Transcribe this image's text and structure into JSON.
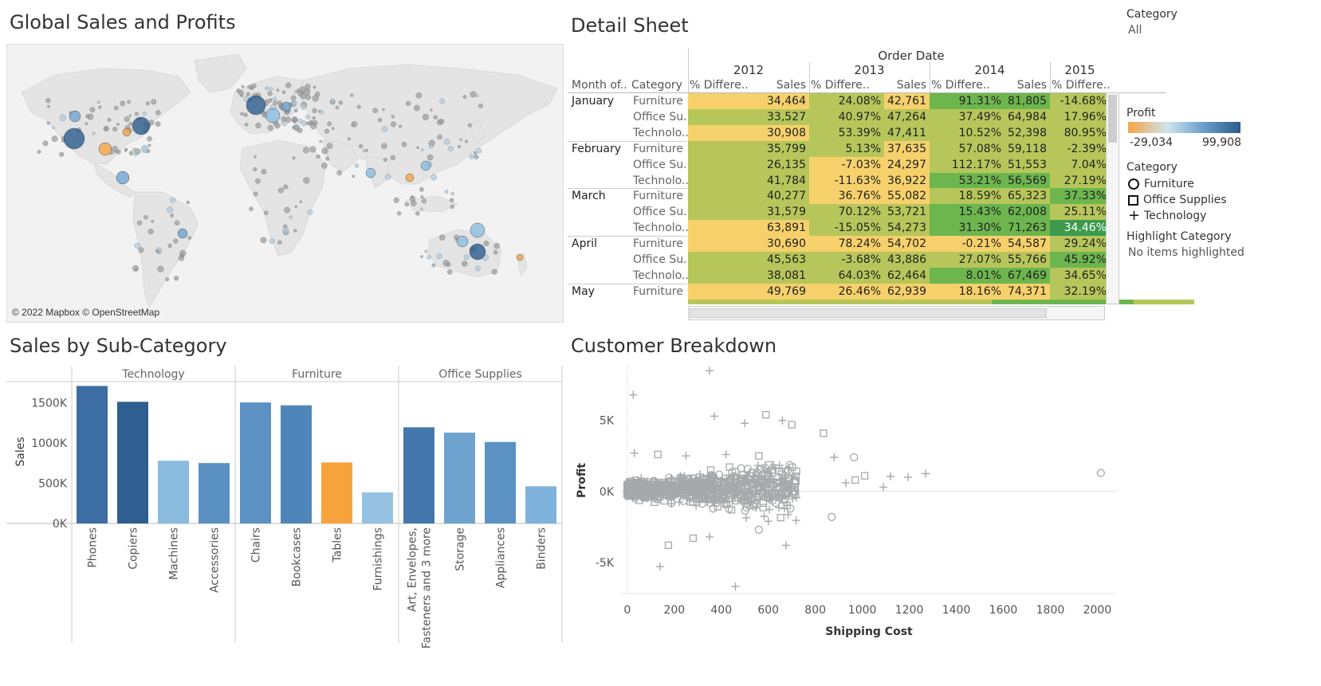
{
  "titles": {
    "map": "Global Sales and Profits",
    "detail": "Detail Sheet",
    "bars": "Sales by Sub-Category",
    "scatter": "Customer Breakdown"
  },
  "map": {
    "attribution": "© 2022 Mapbox © OpenStreetMap",
    "land_color": "#e4e4e4",
    "water_color": "#f2f2f2"
  },
  "filter": {
    "label": "Category",
    "value": "All"
  },
  "profit_legend": {
    "label": "Profit",
    "min": "-29,034",
    "max": "99,908",
    "color_low": "#f4a446",
    "color_mid": "#d0e3ee",
    "color_high": "#2b5b8c"
  },
  "shape_legend": {
    "label": "Category",
    "items": [
      {
        "shape": "circle-icon",
        "label": "Furniture"
      },
      {
        "shape": "square-icon",
        "label": "Office Supplies"
      },
      {
        "shape": "plus-icon",
        "label": "Technology"
      }
    ]
  },
  "highlight": {
    "label": "Highlight Category",
    "value": "No items highlighted"
  },
  "detail_table": {
    "super_header": "Order Date",
    "years": [
      "2012",
      "2013",
      "2014",
      "2015"
    ],
    "row_headers": [
      "Month of..",
      "Category"
    ],
    "col_pct": "% Differe..",
    "col_sales": "Sales",
    "colors": {
      "yellow": "#f6d16b",
      "olive": "#b7c65a",
      "green": "#6db64e",
      "dark": "#3d9a4c"
    },
    "rows": [
      {
        "month": "January",
        "cat": "Furniture",
        "s12": "34,464",
        "p13": "24.08%",
        "s13": "42,761",
        "p14": "91.31%",
        "s14": "81,805",
        "p15": "-14.68%",
        "c": [
          "yellow",
          "olive",
          "yellow",
          "green",
          "green",
          "olive"
        ]
      },
      {
        "month": "",
        "cat": "Office Su..",
        "s12": "33,527",
        "p13": "40.97%",
        "s13": "47,264",
        "p14": "37.49%",
        "s14": "64,984",
        "p15": "17.96%",
        "c": [
          "olive",
          "olive",
          "olive",
          "olive",
          "olive",
          "olive"
        ]
      },
      {
        "month": "",
        "cat": "Technolo..",
        "s12": "30,908",
        "p13": "53.39%",
        "s13": "47,411",
        "p14": "10.52%",
        "s14": "52,398",
        "p15": "80.95%",
        "c": [
          "yellow",
          "olive",
          "olive",
          "olive",
          "olive",
          "olive"
        ]
      },
      {
        "month": "February",
        "cat": "Furniture",
        "s12": "35,799",
        "p13": "5.13%",
        "s13": "37,635",
        "p14": "57.08%",
        "s14": "59,118",
        "p15": "-2.39%",
        "c": [
          "olive",
          "olive",
          "yellow",
          "olive",
          "olive",
          "olive"
        ]
      },
      {
        "month": "",
        "cat": "Office Su..",
        "s12": "26,135",
        "p13": "-7.03%",
        "s13": "24,297",
        "p14": "112.17%",
        "s14": "51,553",
        "p15": "7.04%",
        "c": [
          "olive",
          "yellow",
          "yellow",
          "olive",
          "olive",
          "olive"
        ]
      },
      {
        "month": "",
        "cat": "Technolo..",
        "s12": "41,784",
        "p13": "-11.63%",
        "s13": "36,922",
        "p14": "53.21%",
        "s14": "56,569",
        "p15": "27.19%",
        "c": [
          "olive",
          "yellow",
          "yellow",
          "green",
          "green",
          "olive"
        ]
      },
      {
        "month": "March",
        "cat": "Furniture",
        "s12": "40,277",
        "p13": "36.76%",
        "s13": "55,082",
        "p14": "18.59%",
        "s14": "65,323",
        "p15": "37.33%",
        "c": [
          "olive",
          "yellow",
          "yellow",
          "olive",
          "olive",
          "green"
        ]
      },
      {
        "month": "",
        "cat": "Office Su..",
        "s12": "31,579",
        "p13": "70.12%",
        "s13": "53,721",
        "p14": "15.43%",
        "s14": "62,008",
        "p15": "25.11%",
        "c": [
          "olive",
          "olive",
          "olive",
          "green",
          "green",
          "olive"
        ]
      },
      {
        "month": "",
        "cat": "Technolo..",
        "s12": "63,891",
        "p13": "-15.05%",
        "s13": "54,273",
        "p14": "31.30%",
        "s14": "71,263",
        "p15": "34.46%",
        "c": [
          "yellow",
          "olive",
          "olive",
          "green",
          "green",
          "dark"
        ]
      },
      {
        "month": "April",
        "cat": "Furniture",
        "s12": "30,690",
        "p13": "78.24%",
        "s13": "54,702",
        "p14": "-0.21%",
        "s14": "54,587",
        "p15": "29.24%",
        "c": [
          "yellow",
          "yellow",
          "yellow",
          "yellow",
          "yellow",
          "olive"
        ]
      },
      {
        "month": "",
        "cat": "Office Su..",
        "s12": "45,563",
        "p13": "-3.68%",
        "s13": "43,886",
        "p14": "27.07%",
        "s14": "55,766",
        "p15": "45.92%",
        "c": [
          "olive",
          "olive",
          "olive",
          "olive",
          "olive",
          "green"
        ]
      },
      {
        "month": "",
        "cat": "Technolo..",
        "s12": "38,081",
        "p13": "64.03%",
        "s13": "62,464",
        "p14": "8.01%",
        "s14": "67,469",
        "p15": "34.65%",
        "c": [
          "olive",
          "olive",
          "olive",
          "green",
          "green",
          "olive"
        ]
      },
      {
        "month": "May",
        "cat": "Furniture",
        "s12": "49,769",
        "p13": "26.46%",
        "s13": "62,939",
        "p14": "18.16%",
        "s14": "74,371",
        "p15": "32.19%",
        "c": [
          "yellow",
          "yellow",
          "yellow",
          "yellow",
          "yellow",
          "olive"
        ]
      }
    ]
  },
  "chart_data": [
    {
      "type": "bar",
      "title": "Sales by Sub-Category",
      "ylabel": "Sales",
      "ylim": [
        0,
        1750000
      ],
      "yticks": [
        "0K",
        "500K",
        "1000K",
        "1500K"
      ],
      "ytick_values": [
        0,
        500000,
        1000000,
        1500000
      ],
      "groups": [
        {
          "name": "Technology",
          "categories": [
            "Phones",
            "Copiers",
            "Machines",
            "Accessories"
          ],
          "values": [
            1706824,
            1509436,
            779060,
            749237
          ],
          "colors": [
            "#3c6ea3",
            "#2f5e90",
            "#8bbbdf",
            "#5a90c2"
          ]
        },
        {
          "name": "Furniture",
          "categories": [
            "Chairs",
            "Bookcases",
            "Tables",
            "Furnishings"
          ],
          "values": [
            1501682,
            1466572,
            757042,
            385578
          ],
          "colors": [
            "#5b91c3",
            "#4f86b9",
            "#f7a33d",
            "#95c2e2"
          ]
        },
        {
          "name": "Office Supplies",
          "categories": [
            "Art, Envelopes, Fasteners and 3 more",
            "Storage",
            "Appliances",
            "Binders"
          ],
          "values": [
            1193000,
            1127086,
            1011064,
            461912
          ],
          "colors": [
            "#4477ab",
            "#6fa3cf",
            "#5b91c3",
            "#7fb3dc"
          ]
        }
      ],
      "category_label_lines": {
        "Art, Envelopes, Fasteners and 3 more": [
          "Art, Envelopes,",
          "Fasteners and 3 more"
        ]
      }
    },
    {
      "type": "scatter",
      "title": "Customer Breakdown",
      "xlabel": "Shipping Cost",
      "ylabel": "Profit",
      "xlim": [
        -30,
        2080
      ],
      "ylim": [
        -7200,
        8800
      ],
      "xticks": [
        0,
        200,
        400,
        600,
        800,
        1000,
        1200,
        1400,
        1600,
        1800,
        2000
      ],
      "ytick_values": [
        -5000,
        0,
        5000
      ],
      "ytick_labels": [
        "-5K",
        "0K",
        "5K"
      ],
      "point_color": "#a6a9ab",
      "points": [
        {
          "x": 2015,
          "y": 1300,
          "shape": "circle"
        },
        {
          "x": 1270,
          "y": 1250,
          "shape": "plus"
        },
        {
          "x": 1195,
          "y": 1000,
          "shape": "plus"
        },
        {
          "x": 1120,
          "y": 1050,
          "shape": "plus"
        },
        {
          "x": 1090,
          "y": 300,
          "shape": "plus"
        },
        {
          "x": 1010,
          "y": 1100,
          "shape": "square"
        },
        {
          "x": 970,
          "y": 800,
          "shape": "square"
        },
        {
          "x": 965,
          "y": 2400,
          "shape": "circle"
        },
        {
          "x": 930,
          "y": 600,
          "shape": "plus"
        },
        {
          "x": 880,
          "y": 2400,
          "shape": "plus"
        },
        {
          "x": 835,
          "y": 4100,
          "shape": "square"
        },
        {
          "x": 870,
          "y": -1800,
          "shape": "circle"
        },
        {
          "x": 700,
          "y": 4700,
          "shape": "square"
        },
        {
          "x": 660,
          "y": 5000,
          "shape": "plus"
        },
        {
          "x": 590,
          "y": 5400,
          "shape": "square"
        },
        {
          "x": 500,
          "y": 4800,
          "shape": "plus"
        },
        {
          "x": 370,
          "y": 5300,
          "shape": "plus"
        },
        {
          "x": 350,
          "y": 8500,
          "shape": "plus"
        },
        {
          "x": 25,
          "y": 6800,
          "shape": "plus"
        },
        {
          "x": 675,
          "y": -3800,
          "shape": "plus"
        },
        {
          "x": 460,
          "y": -6700,
          "shape": "plus"
        },
        {
          "x": 140,
          "y": -5300,
          "shape": "plus"
        },
        {
          "x": 175,
          "y": -3800,
          "shape": "square"
        },
        {
          "x": 280,
          "y": -3300,
          "shape": "square"
        },
        {
          "x": 350,
          "y": -3200,
          "shape": "plus"
        },
        {
          "x": 560,
          "y": -2700,
          "shape": "circle"
        },
        {
          "x": 600,
          "y": -2100,
          "shape": "plus"
        },
        {
          "x": 30,
          "y": 2700,
          "shape": "plus"
        },
        {
          "x": 130,
          "y": 2600,
          "shape": "square"
        },
        {
          "x": 250,
          "y": 2500,
          "shape": "plus"
        },
        {
          "x": 420,
          "y": 2600,
          "shape": "plus"
        },
        {
          "x": 560,
          "y": 2500,
          "shape": "square"
        }
      ]
    }
  ]
}
